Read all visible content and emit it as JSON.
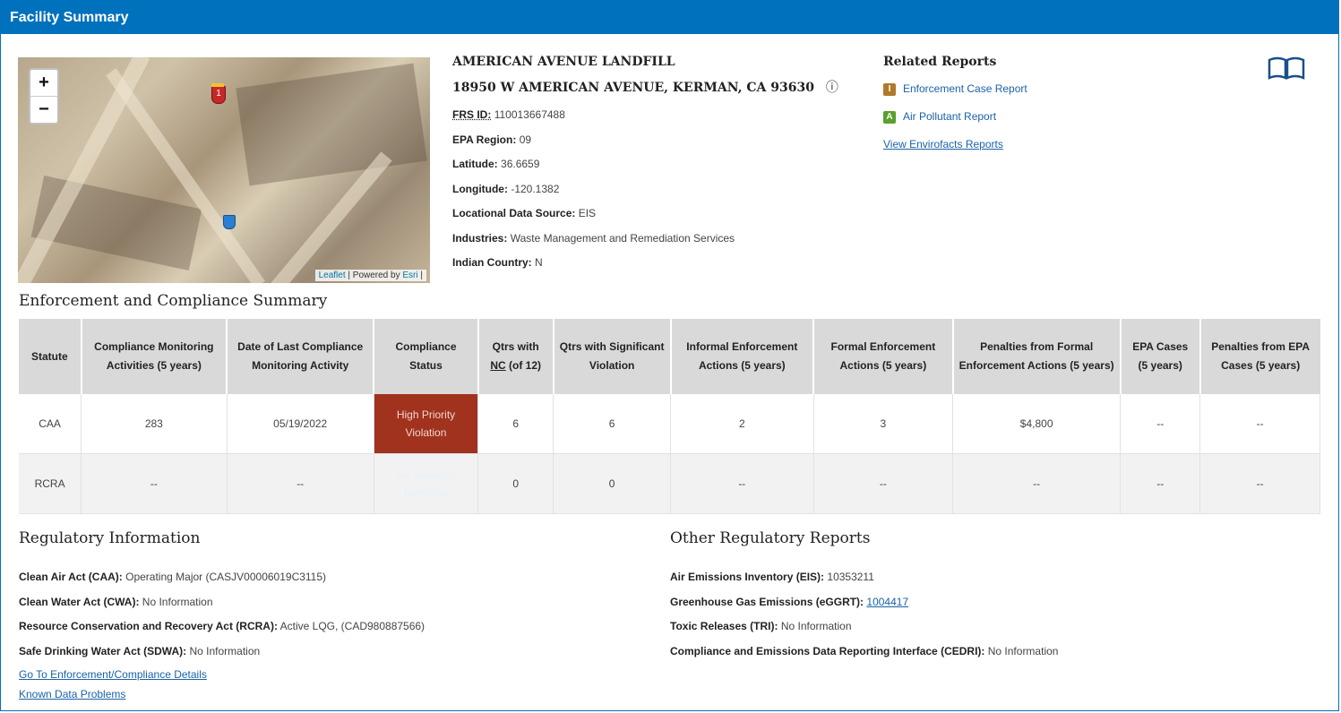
{
  "panel": {
    "title": "Facility Summary"
  },
  "map": {
    "zoom_in": "+",
    "zoom_out": "−",
    "marker_label": "1",
    "attribution_leaflet": "Leaflet",
    "attribution_sep": " | Powered by ",
    "attribution_esri": "Esri",
    "attribution_end": " |"
  },
  "facility": {
    "name": "AMERICAN AVENUE LANDFILL",
    "address": "18950 W AMERICAN AVENUE, KERMAN, CA 93630",
    "info_icon": "ⓘ",
    "fields": [
      {
        "label": "FRS ID:",
        "value": "110013667488"
      },
      {
        "label": "EPA Region:",
        "value": "09"
      },
      {
        "label": "Latitude:",
        "value": "36.6659"
      },
      {
        "label": "Longitude:",
        "value": "-120.1382"
      },
      {
        "label": "Locational Data Source:",
        "value": "EIS"
      },
      {
        "label": "Industries:",
        "value": "Waste Management and Remediation Services"
      },
      {
        "label": "Indian Country:",
        "value": "N"
      }
    ]
  },
  "related_reports": {
    "title": "Related Reports",
    "enforcement_case": {
      "icon": "I",
      "label": "Enforcement Case Report"
    },
    "air_pollutant": {
      "icon": "A",
      "label": "Air Pollutant Report"
    },
    "envirofacts": "View Envirofacts Reports"
  },
  "ecs": {
    "title": "Enforcement and Compliance Summary",
    "headers": [
      "Statute",
      "Compliance Monitoring Activities (5 years)",
      "Date of Last Compliance Monitoring Activity",
      "Compliance Status",
      "Qtrs with NC (of 12)",
      "Qtrs with Significant Violation",
      "Informal Enforcement Actions (5 years)",
      "Formal Enforcement Actions (5 years)",
      "Penalties from Formal Enforcement Actions (5 years)",
      "EPA Cases (5 years)",
      "Penalties from EPA Cases (5 years)"
    ],
    "rows": [
      [
        "CAA",
        "283",
        "05/19/2022",
        "High Priority Violation",
        "6",
        "6",
        "2",
        "3",
        "$4,800",
        "--",
        "--"
      ],
      [
        "RCRA",
        "--",
        "--",
        "No Violation Identified",
        "0",
        "0",
        "--",
        "--",
        "--",
        "--",
        "--"
      ]
    ],
    "status_colors": {
      "high_priority": "#a0321e",
      "no_violation": "#4a90e2"
    }
  },
  "regulatory": {
    "title": "Regulatory Information",
    "rows": [
      {
        "label": "Clean Air Act (CAA):",
        "value": "Operating Major (CASJV00006019C3115)"
      },
      {
        "label": "Clean Water Act (CWA):",
        "value": "No Information"
      },
      {
        "label": "Resource Conservation and Recovery Act (RCRA):",
        "value": "Active LQG, (CAD980887566)"
      },
      {
        "label": "Safe Drinking Water Act (SDWA):",
        "value": "No Information"
      }
    ],
    "link_details": "Go To Enforcement/Compliance Details",
    "link_problems": "Known Data Problems"
  },
  "other_reports": {
    "title": "Other Regulatory Reports",
    "eis": {
      "label": "Air Emissions Inventory (EIS):",
      "value": "10353211"
    },
    "eggrt": {
      "label": "Greenhouse Gas Emissions (eGGRT):",
      "value": "1004417"
    },
    "tri": {
      "label": "Toxic Releases (TRI):",
      "value": "No Information"
    },
    "cedri": {
      "label": "Compliance and Emissions Data Reporting Interface (CEDRI):",
      "value": "No Information"
    }
  },
  "colors": {
    "brand": "#0071bc",
    "link": "#1a62a8",
    "header_bg": "#d9d9d9"
  }
}
